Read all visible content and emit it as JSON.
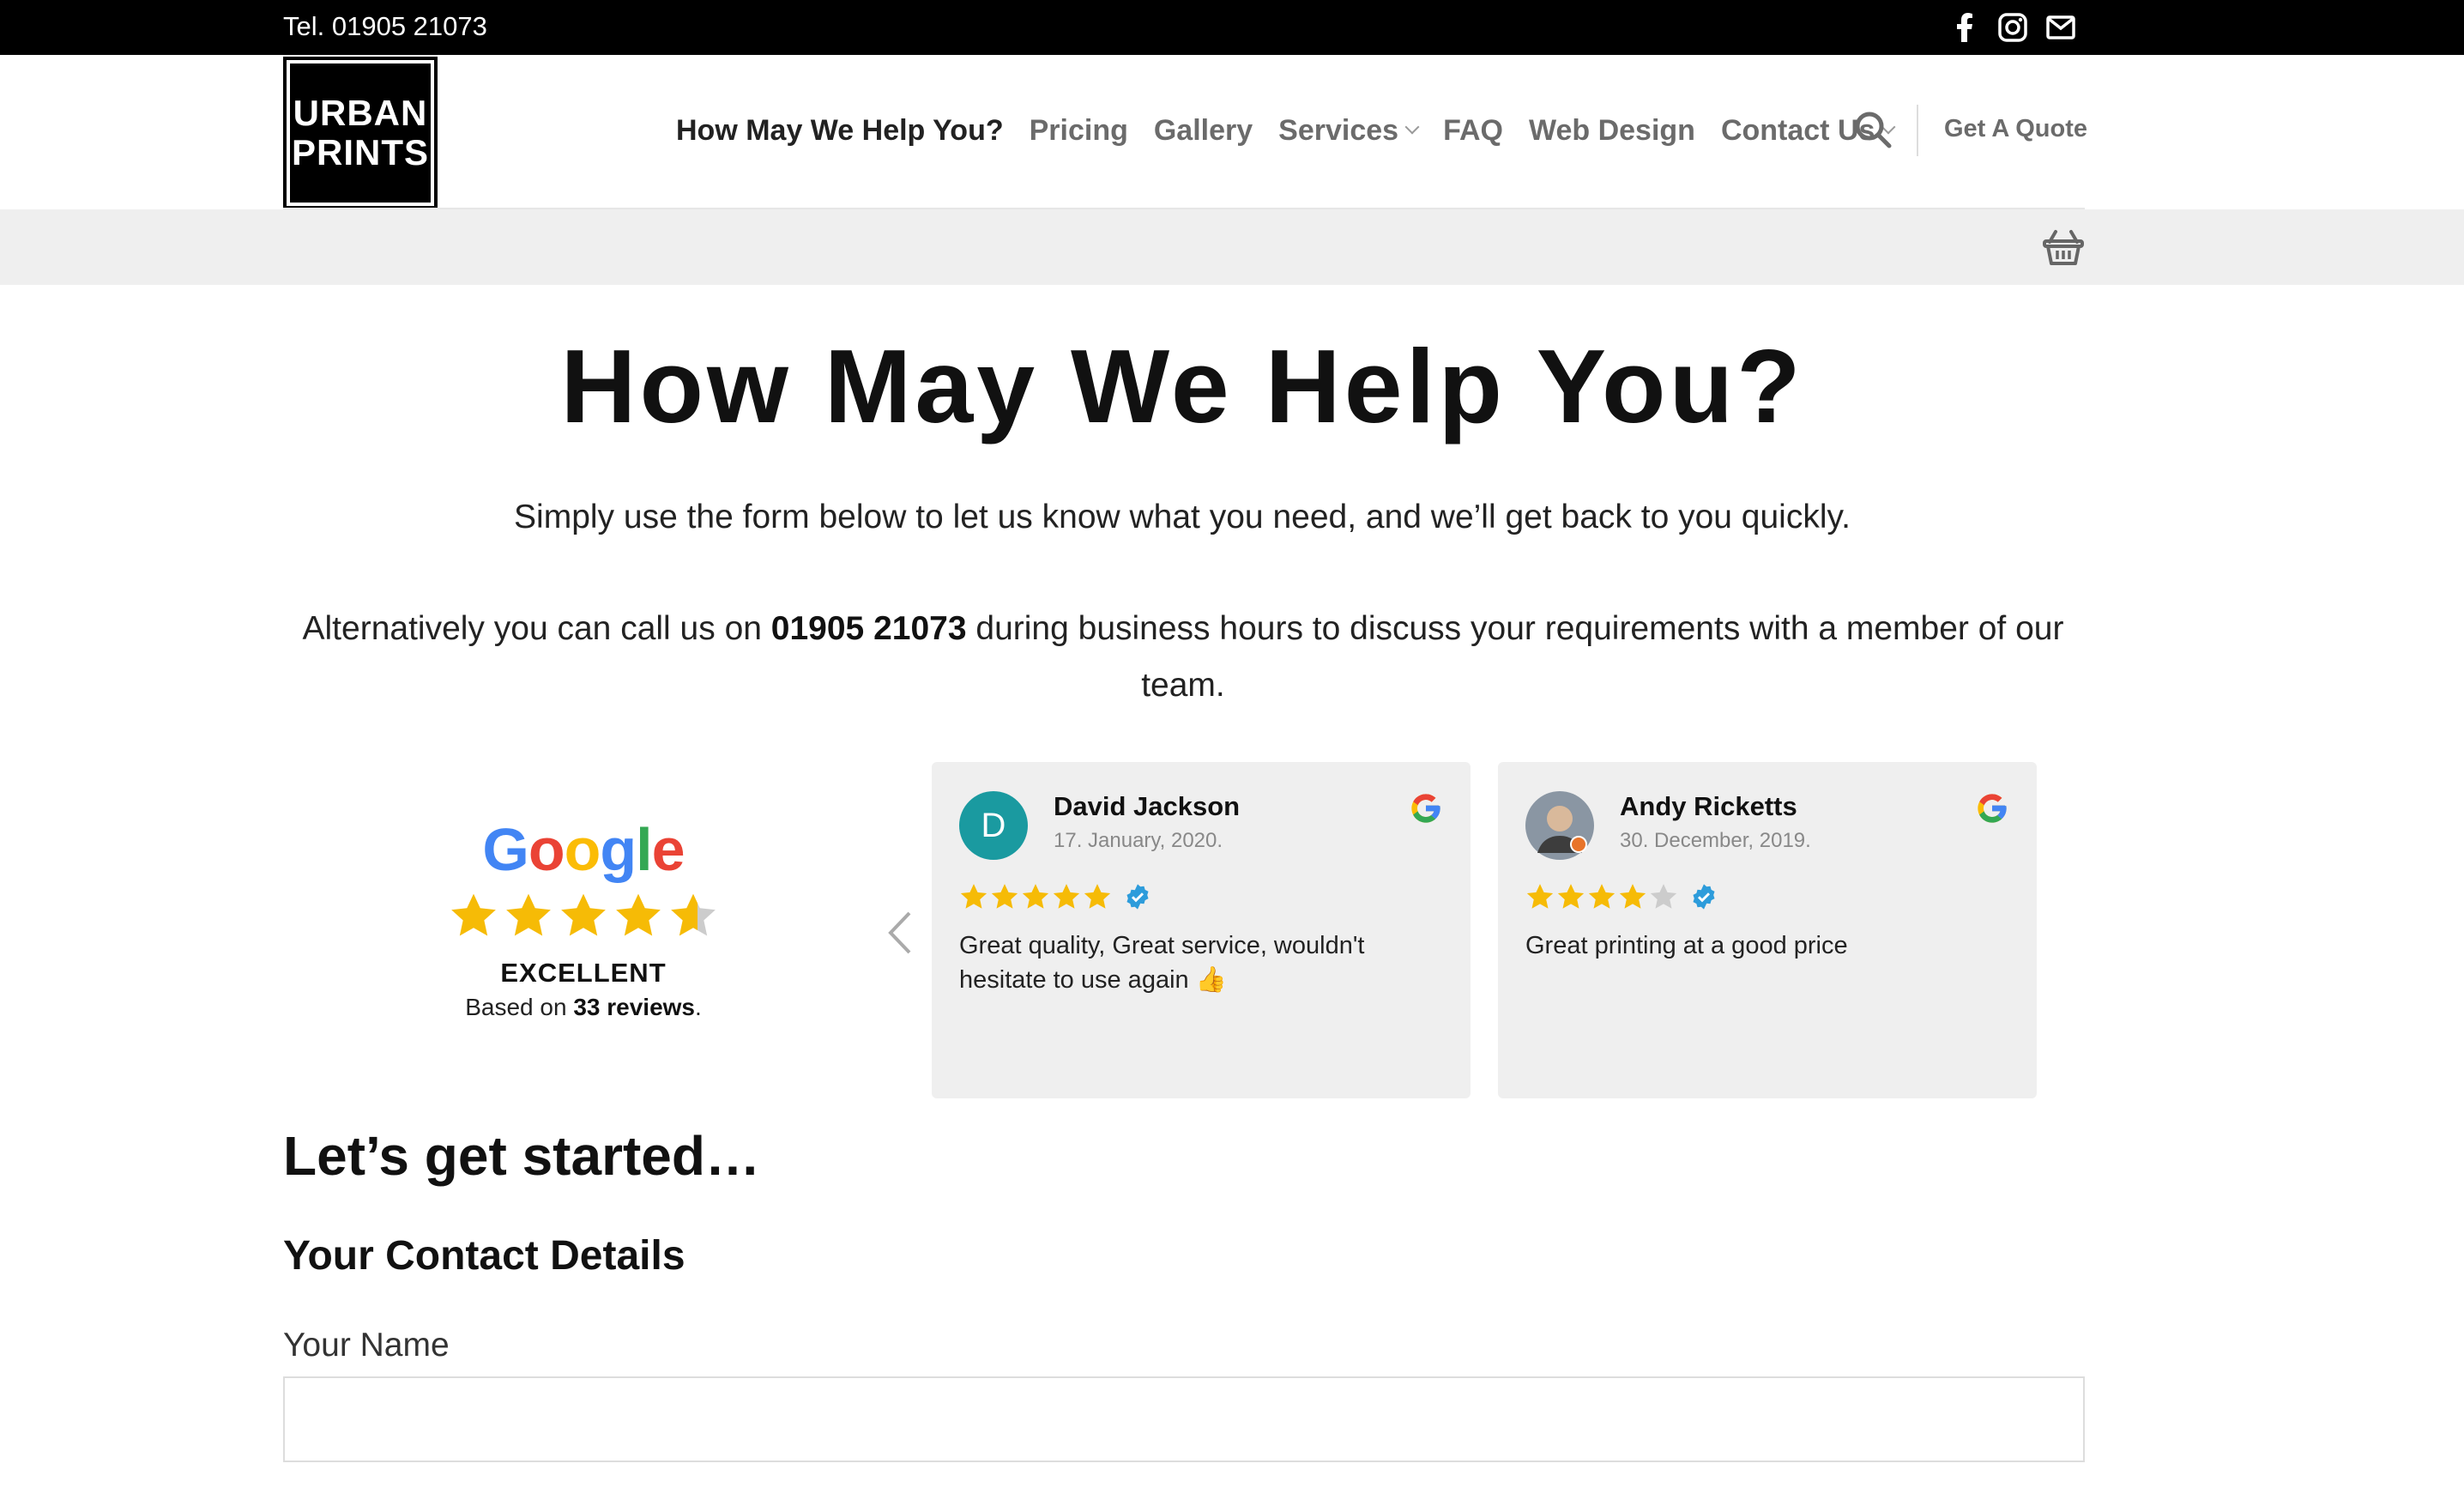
{
  "topbar": {
    "tel": "Tel. 01905 21073",
    "social": [
      {
        "icon": "facebook-icon"
      },
      {
        "icon": "instagram-icon"
      },
      {
        "icon": "envelope-icon"
      }
    ]
  },
  "header": {
    "logo_line1": "URBAN",
    "logo_line2": "PRINTS",
    "nav": [
      {
        "label": "How May We Help You?",
        "active": true
      },
      {
        "label": "Pricing"
      },
      {
        "label": "Gallery"
      },
      {
        "label": "Services",
        "dropdown": true
      },
      {
        "label": "FAQ"
      },
      {
        "label": "Web Design"
      },
      {
        "label": "Contact Us",
        "dropdown": true
      }
    ],
    "quote_label": "Get A Quote"
  },
  "main": {
    "title": "How May We Help You?",
    "lead": "Simply use the form below to let us know what you need, and we’ll get back to you quickly.",
    "alt_before": "Alternatively you can call us on ",
    "alt_phone": "01905 21073",
    "alt_after": " during business hours to discuss your requirements with a member of our team."
  },
  "reviews": {
    "summary": {
      "brand": "Google",
      "rating": 4.6,
      "label": "EXCELLENT",
      "based_prefix": "Based on ",
      "count_text": "33 reviews",
      "based_suffix": "."
    },
    "items": [
      {
        "name": "David Jackson",
        "date": "17. January, 2020.",
        "initial": "D",
        "avatar_color": "#1a9aa0",
        "stars": 5,
        "text": "Great quality, Great service, wouldn't hesitate to use again 👍"
      },
      {
        "name": "Andy Ricketts",
        "date": "30. December, 2019.",
        "initial": "",
        "avatar_color": "#7a8a99",
        "stars": 4,
        "text": "Great printing at a good price"
      }
    ]
  },
  "form": {
    "heading": "Let’s get started…",
    "section": "Your Contact Details",
    "name_label": "Your Name",
    "name_value": ""
  },
  "colors": {
    "star": "#f6bb06",
    "star_empty": "#cccccc",
    "verified": "#2d9cdb",
    "google_blue": "#4285F4",
    "google_red": "#EA4335",
    "google_yellow": "#FBBC05",
    "google_green": "#34A853"
  }
}
